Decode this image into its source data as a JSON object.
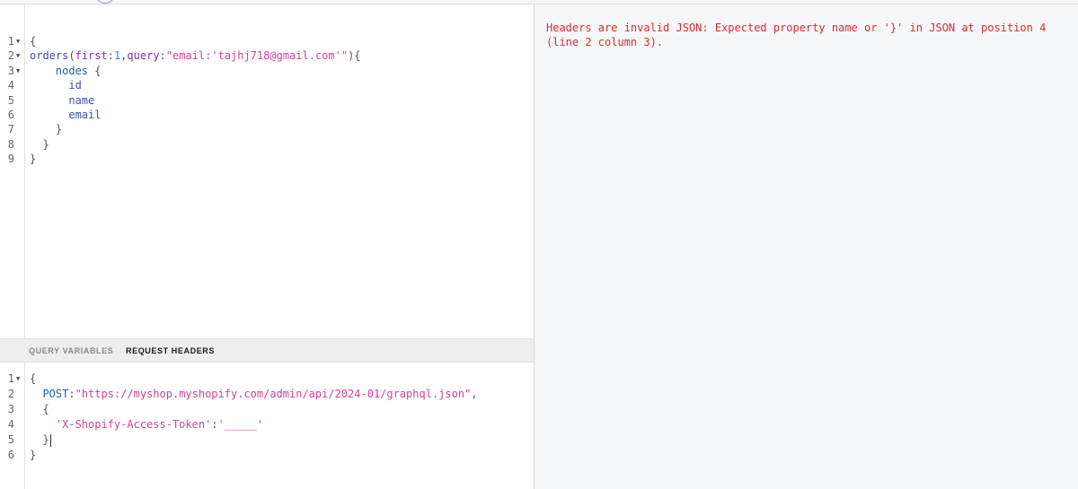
{
  "query_editor": {
    "lines": [
      {
        "num": "1",
        "fold": "▼",
        "tokens": [
          {
            "t": "{",
            "c": "punct"
          }
        ]
      },
      {
        "num": "2",
        "fold": "▼",
        "tokens": [
          {
            "t": "orders",
            "c": "kw-field query"
          },
          {
            "t": "(",
            "c": "punct"
          },
          {
            "t": "first",
            "c": "kw-arg"
          },
          {
            "t": ":",
            "c": "punct"
          },
          {
            "t": "1",
            "c": "kw-num"
          },
          {
            "t": ",",
            "c": "punct"
          },
          {
            "t": "query",
            "c": "kw-arg"
          },
          {
            "t": ":",
            "c": "punct"
          },
          {
            "t": "\"email:'tajhj718@gmail.com'\"",
            "c": "kw-str"
          },
          {
            "t": "){",
            "c": "punct"
          }
        ]
      },
      {
        "num": "3",
        "fold": "▼",
        "tokens": [
          {
            "t": "    ",
            "c": "punct"
          },
          {
            "t": "nodes",
            "c": "kw-nodes"
          },
          {
            "t": " {",
            "c": "punct"
          }
        ]
      },
      {
        "num": "4",
        "fold": "",
        "tokens": [
          {
            "t": "      ",
            "c": "punct"
          },
          {
            "t": "id",
            "c": "kw-sub"
          }
        ]
      },
      {
        "num": "5",
        "fold": "",
        "tokens": [
          {
            "t": "      ",
            "c": "punct"
          },
          {
            "t": "name",
            "c": "kw-sub"
          }
        ]
      },
      {
        "num": "6",
        "fold": "",
        "tokens": [
          {
            "t": "      ",
            "c": "punct"
          },
          {
            "t": "email",
            "c": "kw-sub"
          }
        ]
      },
      {
        "num": "7",
        "fold": "",
        "tokens": [
          {
            "t": "    }",
            "c": "punct"
          }
        ]
      },
      {
        "num": "8",
        "fold": "",
        "tokens": [
          {
            "t": "  }",
            "c": "punct"
          }
        ]
      },
      {
        "num": "9",
        "fold": "",
        "tokens": [
          {
            "t": "}",
            "c": "punct"
          }
        ]
      }
    ]
  },
  "tabs": {
    "query_variables": "QUERY VARIABLES",
    "request_headers": "REQUEST HEADERS"
  },
  "headers_editor": {
    "lines": [
      {
        "num": "1",
        "fold": "▼",
        "tokens": [
          {
            "t": "{",
            "c": "punct"
          }
        ]
      },
      {
        "num": "2",
        "fold": "",
        "tokens": [
          {
            "t": "  ",
            "c": "punct"
          },
          {
            "t": "POST",
            "c": "kw-prop"
          },
          {
            "t": ":",
            "c": "punct"
          },
          {
            "t": "\"https://myshop.myshopify.com/admin/api/2024-01/graphql.json\"",
            "c": "kw-str"
          },
          {
            "t": ",",
            "c": "punct"
          }
        ]
      },
      {
        "num": "3",
        "fold": "",
        "tokens": [
          {
            "t": "  {",
            "c": "punct"
          }
        ]
      },
      {
        "num": "4",
        "fold": "",
        "tokens": [
          {
            "t": "    ",
            "c": "punct"
          },
          {
            "t": "'X-Shopify-Access-Token'",
            "c": "kw-str"
          },
          {
            "t": ":",
            "c": "punct"
          },
          {
            "t": "'_____'",
            "c": "kw-str"
          }
        ]
      },
      {
        "num": "5",
        "fold": "",
        "tokens": [
          {
            "t": "  }",
            "c": "punct"
          }
        ],
        "cursor": true
      },
      {
        "num": "6",
        "fold": "",
        "tokens": [
          {
            "t": "}",
            "c": "punct"
          }
        ]
      }
    ]
  },
  "result": {
    "error": "Headers are invalid JSON: Expected property name or '}' in JSON at position 4 (line 2 column 3)."
  }
}
